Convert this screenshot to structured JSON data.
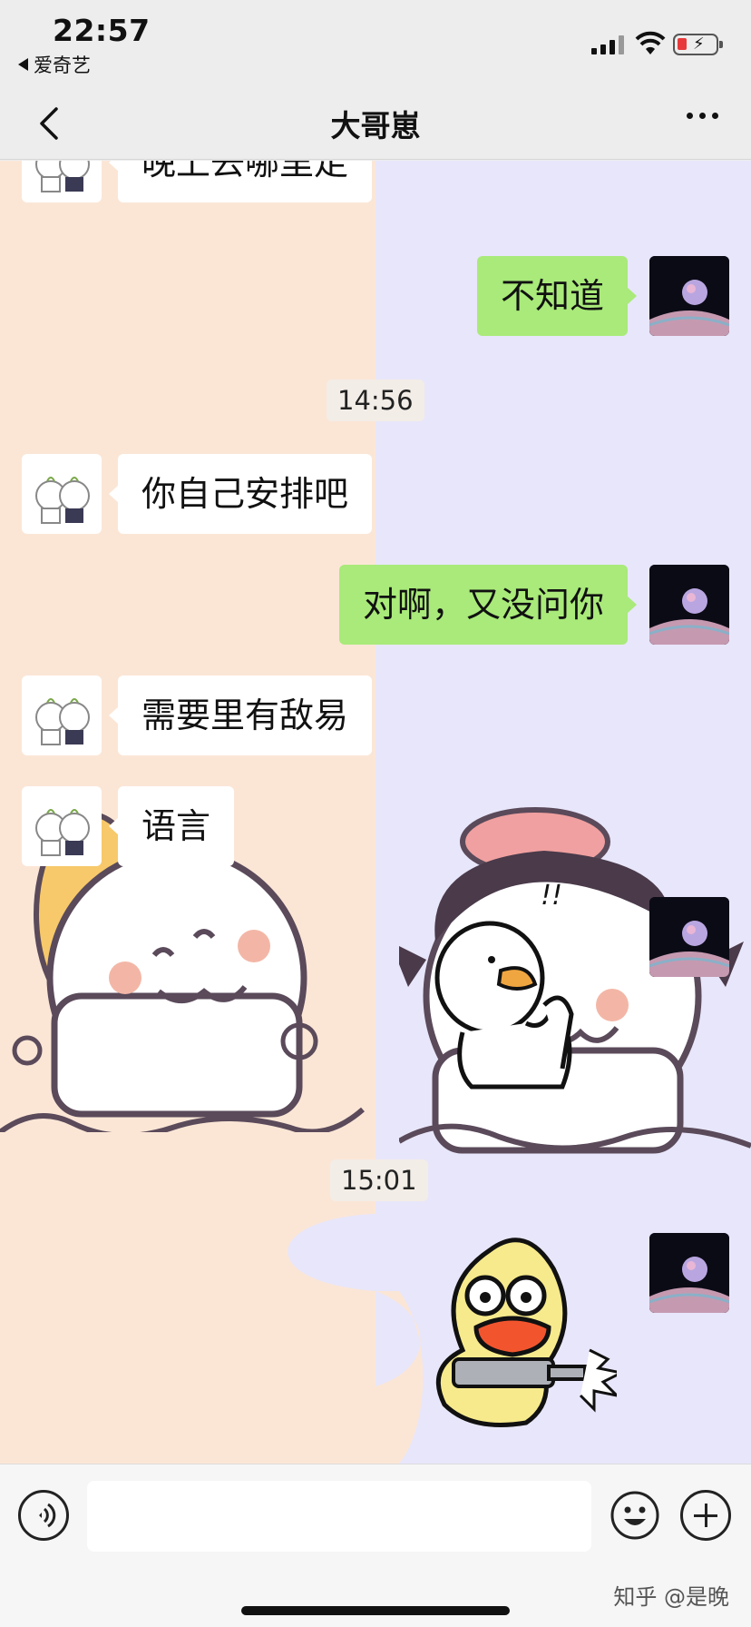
{
  "status_bar": {
    "time": "22:57",
    "back_app_label": "爱奇艺"
  },
  "nav": {
    "title": "大哥崽"
  },
  "messages": [
    {
      "side": "in",
      "text": "晚上去哪里走"
    },
    {
      "side": "out",
      "text": "不知道"
    },
    {
      "side": "in",
      "text": "你自己安排吧"
    },
    {
      "side": "out",
      "text": "对啊，又没问你"
    },
    {
      "side": "in",
      "text": "需要里有敌易"
    },
    {
      "side": "in",
      "text": "语言"
    }
  ],
  "timestamps": [
    "14:56",
    "15:01"
  ],
  "sticker_texts": {
    "exclaim": "!!"
  },
  "watermark": "知乎 @是晚",
  "colors": {
    "bubble_out": "#a9ea7a",
    "bubble_in": "#ffffff",
    "bg_left": "#fbe6d6",
    "bg_right": "#e8e6fa",
    "battery_low": "#e8393a"
  }
}
